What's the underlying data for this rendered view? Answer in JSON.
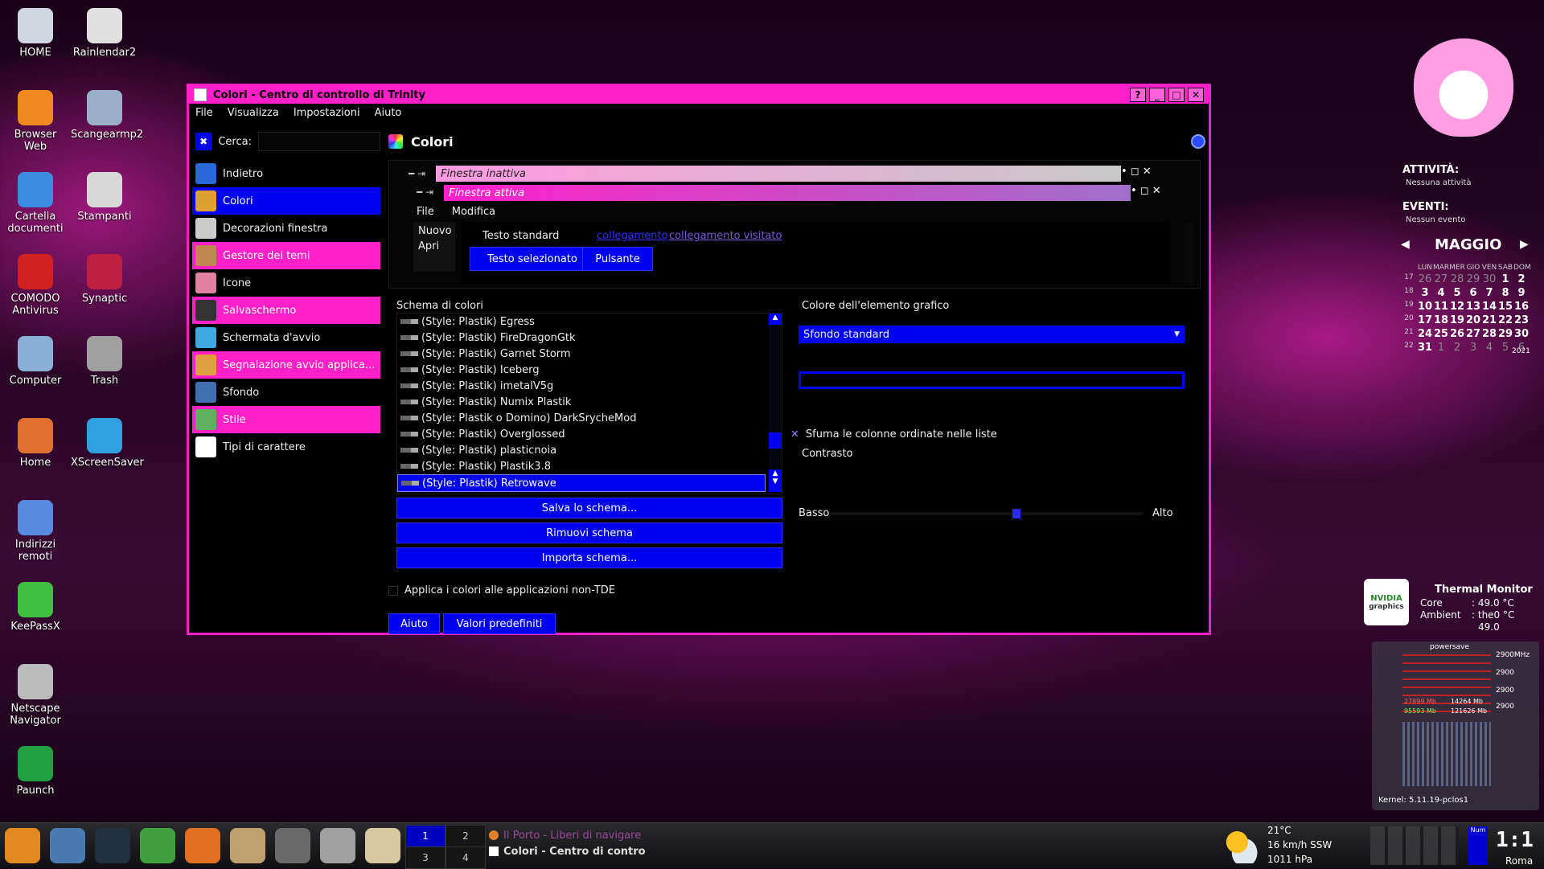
{
  "desktop_icons_left": [
    {
      "label": "HOME",
      "icon": "home-drive-icon",
      "color": "#cfd6e0"
    },
    {
      "label": "Browser Web",
      "icon": "browser-globe-icon",
      "color": "#f08a20"
    },
    {
      "label": "Cartella documenti",
      "icon": "folder-icon",
      "color": "#3a8de0"
    },
    {
      "label": "COMODO Antivirus",
      "icon": "comodo-shield-icon",
      "color": "#d02020"
    },
    {
      "label": "Computer",
      "icon": "computer-icon",
      "color": "#8ab0d8"
    },
    {
      "label": "Home",
      "icon": "house-icon",
      "color": "#e07030"
    },
    {
      "label": "Indirizzi remoti",
      "icon": "network-globe-icon",
      "color": "#5a8ae0"
    },
    {
      "label": "KeePassX",
      "icon": "keepass-icon",
      "color": "#40c040"
    },
    {
      "label": "Netscape Navigator",
      "icon": "netscape-icon",
      "color": "#bbbbbb"
    },
    {
      "label": "Paunch",
      "icon": "paunch-icon",
      "color": "#20a040"
    }
  ],
  "desktop_icons_right": [
    {
      "label": "Rainlendar2",
      "icon": "rainlendar-icon",
      "color": "#e0e0e0"
    },
    {
      "label": "Scangearmp2",
      "icon": "scanner-icon",
      "color": "#9ab0c8"
    },
    {
      "label": "Stampanti",
      "icon": "printer-icon",
      "color": "#d8d8d8"
    },
    {
      "label": "Synaptic",
      "icon": "synaptic-icon",
      "color": "#c02040"
    },
    {
      "label": "Trash",
      "icon": "trash-icon",
      "color": "#a0a0a0"
    },
    {
      "label": "XScreenSaver",
      "icon": "xscreensaver-icon",
      "color": "#30a0e0"
    }
  ],
  "window": {
    "title": "Colori - Centro di controllo di Trinity",
    "buttons": [
      "?",
      "_",
      "□",
      "✕"
    ],
    "menu": [
      "File",
      "Visualizza",
      "Impostazioni",
      "Aiuto"
    ]
  },
  "sidebar": {
    "search_label": "Cerca:",
    "items": [
      {
        "label": "Indietro",
        "icon": "back-arrow-icon",
        "state": "normal",
        "color": "#2a6ad8"
      },
      {
        "label": "Colori",
        "icon": "colors-icon",
        "state": "selected",
        "color": "#e0a030"
      },
      {
        "label": "Decorazioni finestra",
        "icon": "window-decor-icon",
        "state": "normal",
        "color": "#cccccc"
      },
      {
        "label": "Gestore dei temi",
        "icon": "theme-manager-icon",
        "state": "pink",
        "color": "#c08850"
      },
      {
        "label": "Icone",
        "icon": "icons-icon",
        "state": "normal",
        "color": "#e080a0"
      },
      {
        "label": "Salvaschermo",
        "icon": "screensaver-icon",
        "state": "pink",
        "color": "#333333"
      },
      {
        "label": "Schermata d'avvio",
        "icon": "splash-icon",
        "state": "normal",
        "color": "#40a8e0"
      },
      {
        "label": "Segnalazione avvio applica...",
        "icon": "launch-feedback-icon",
        "state": "pink",
        "color": "#e0a040"
      },
      {
        "label": "Sfondo",
        "icon": "wallpaper-icon",
        "state": "normal",
        "color": "#4070b0"
      },
      {
        "label": "Stile",
        "icon": "style-icon",
        "state": "pink",
        "color": "#60b060"
      },
      {
        "label": "Tipi di carattere",
        "icon": "fonts-icon",
        "state": "normal",
        "color": "#ffffff"
      }
    ]
  },
  "content": {
    "title": "Colori",
    "preview": {
      "inactive_title": "Finestra inattiva",
      "active_title": "Finestra attiva",
      "menu": [
        "File",
        "Modifica"
      ],
      "list_items": [
        "Nuovo",
        "Apri"
      ],
      "standard_text": "Testo standard",
      "link": "collegamento",
      "visited_link": "collegamento visitato",
      "selected_text": "Testo selezionato",
      "button": "Pulsante"
    },
    "scheme_label": "Schema di colori",
    "schemes": [
      "(Style: Plastik) Egress",
      "(Style: Plastik) FireDragonGtk",
      "(Style: Plastik) Garnet Storm",
      "(Style: Plastik) Iceberg",
      "(Style: Plastik) imetalV5g",
      "(Style: Plastik) Numix Plastik",
      "(Style: Plastik o Domino) DarkSrycheMod",
      "(Style: Plastik) Overglossed",
      "(Style: Plastik) plasticnoia",
      "(Style: Plastik) Plastik3.8",
      "(Style: Plastik) Retrowave"
    ],
    "selected_scheme_index": 10,
    "save_scheme": "Salva lo schema...",
    "remove_scheme": "Rimuovi schema",
    "import_scheme": "Importa schema...",
    "widget_color_label": "Colore dell'elemento grafico",
    "widget_color_value": "Sfondo standard",
    "fade_sorted": "Sfuma le colonne ordinate nelle liste",
    "contrast_label": "Contrasto",
    "contrast_low": "Basso",
    "contrast_high": "Alto",
    "contrast_level": 0.6,
    "apply_non_tde": "Applica i colori alle applicazioni non-TDE",
    "help_button": "Aiuto",
    "defaults_button": "Valori predefiniti"
  },
  "agenda": {
    "activity_label": "ATTIVITÀ:",
    "activity_value": "Nessuna attività",
    "events_label": "EVENTI:",
    "events_value": "Nessun evento",
    "month": "MAGGIO",
    "year": "2021",
    "weekdays": [
      "LUN",
      "MAR",
      "MER",
      "GIO",
      "VEN",
      "SAB",
      "DOM"
    ],
    "weeks": [
      {
        "wk": "17",
        "days": [
          "26",
          "27",
          "28",
          "29",
          "30",
          "1",
          "2"
        ]
      },
      {
        "wk": "18",
        "days": [
          "3",
          "4",
          "5",
          "6",
          "7",
          "8",
          "9"
        ]
      },
      {
        "wk": "19",
        "days": [
          "10",
          "11",
          "12",
          "13",
          "14",
          "15",
          "16"
        ]
      },
      {
        "wk": "20",
        "days": [
          "17",
          "18",
          "19",
          "20",
          "21",
          "22",
          "23"
        ]
      },
      {
        "wk": "21",
        "days": [
          "24",
          "25",
          "26",
          "27",
          "28",
          "29",
          "30"
        ]
      },
      {
        "wk": "22",
        "days": [
          "31",
          "1",
          "2",
          "3",
          "4",
          "5",
          "6"
        ]
      }
    ]
  },
  "thermal": {
    "title": "Thermal Monitor",
    "core_label": "Core",
    "core_value": ": 49.0 °C",
    "ambient_label": "Ambient",
    "ambient_value": ": the0 °C",
    "extra_value": "49.0",
    "nvidia_label": "NVIDIA",
    "nvidia_sub": "graphics"
  },
  "sysmon": {
    "header": "powersave",
    "kernel": "Kernel: 5.11.19-pclos1",
    "freqs": [
      "2900MHz",
      "2900",
      "2900",
      "2900"
    ],
    "mem": [
      "27899 Mb",
      "14264 Mb",
      "95593 Mb",
      "121626 Mb"
    ]
  },
  "taskbar": {
    "launchers": [
      "tde-menu-icon",
      "desktop-preview-icon",
      "terminal-icon",
      "keepass-launch-icon",
      "firefox-icon",
      "settings-icon",
      "netscape-launch-icon",
      "clock-app-icon",
      "gimp-icon"
    ],
    "pager": [
      "1",
      "2",
      "3",
      "4"
    ],
    "tasks": [
      "Il Porto - Liberi di navigare",
      "Colori - Centro di contro"
    ],
    "weather_temp": "21°C",
    "weather_wind": "16 km/h SSW",
    "weather_pressure": "1011 hPa",
    "num_label": "Num",
    "clock": "1:1",
    "clock_city": "Roma"
  }
}
